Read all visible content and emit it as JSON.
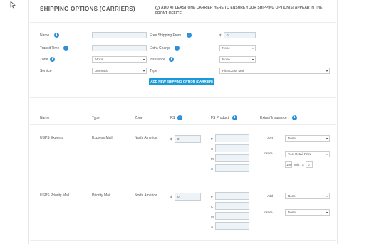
{
  "header": {
    "title": "SHIPPING OPTIONS (CARRIERS)",
    "notice": "ADD AT LEAST ONE CARRIER HERE TO ENSURE YOUR SHIPPING OPTION(S) APPEAR IN THE FRONT OFFICE."
  },
  "form": {
    "name_label": "Name",
    "transit_label": "Transit Time",
    "zone_label": "Zone",
    "zone_value": "Africa",
    "service_label": "Service",
    "service_value": "Domestic",
    "free_ship_label": "Free Shipping From",
    "free_ship_currency": "$",
    "free_ship_value": "0",
    "extra_label": "Extra Charge",
    "extra_value": "None",
    "insurance_label": "Insurance",
    "insurance_value": "None",
    "type_label": "Type",
    "type_value": "First Class Mail",
    "add_button": "ADD NEW SHIPPING OPTION (CARRIER)"
  },
  "table": {
    "headers": {
      "name": "Name",
      "type": "Type",
      "zone": "Zone",
      "fs": "FS",
      "fs_product": "FS Product",
      "extra": "Extra / Insurance"
    },
    "rows": [
      {
        "name": "USPS Express",
        "type": "Express Mail",
        "zone": "North America",
        "fs_currency": "$",
        "fs_value": "0",
        "fs_letters": [
          "P",
          "C",
          "M",
          "S"
        ],
        "add_label": "Add",
        "add_value": "None",
        "insure_label": "Insure",
        "insure_value": "% of Retail Price",
        "pct": "100",
        "min_label": "Min:",
        "min_currency": "$",
        "min_value": "0"
      },
      {
        "name": "USPS Priority Mail",
        "type": "Priority Mail",
        "zone": "North America",
        "fs_currency": "$",
        "fs_value": "0",
        "fs_letters": [
          "P",
          "C",
          "M",
          "S"
        ],
        "add_label": "Add",
        "add_value": "None",
        "insure_label": "Insure",
        "insure_value": "None"
      }
    ]
  },
  "icons": {
    "info": "info-icon",
    "cursor": "mouse-cursor-icon",
    "notice": "info-circle-icon",
    "dropdown": "caret-down-icon"
  },
  "colors": {
    "accent": "#1a9ad6",
    "info": "#2f8fd6"
  }
}
